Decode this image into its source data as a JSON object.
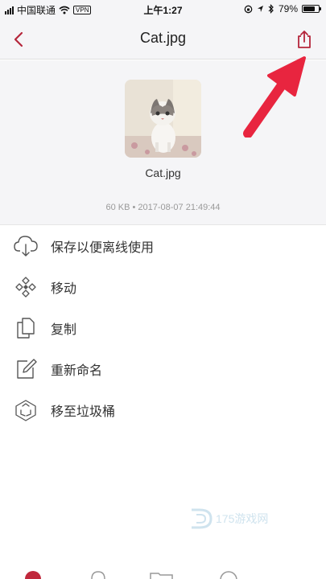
{
  "status": {
    "carrier": "中国联通",
    "vpn": "VPN",
    "time": "上午1:27",
    "battery": "79%",
    "battery_level": 0.79
  },
  "nav": {
    "back_icon": "chevron-left-icon",
    "title": "Cat.jpg",
    "share_icon": "share-icon",
    "accent_color": "#b5263b"
  },
  "file": {
    "name": "Cat.jpg",
    "meta": "60 KB • 2017-08-07 21:49:44"
  },
  "menu": [
    {
      "label": "保存以便离线使用",
      "icon": "cloud-download-icon"
    },
    {
      "label": "移动",
      "icon": "move-icon"
    },
    {
      "label": "复制",
      "icon": "copy-icon"
    },
    {
      "label": "重新命名",
      "icon": "rename-icon"
    },
    {
      "label": "移至垃圾桶",
      "icon": "trash-icon"
    }
  ],
  "watermark": "175游戏网"
}
